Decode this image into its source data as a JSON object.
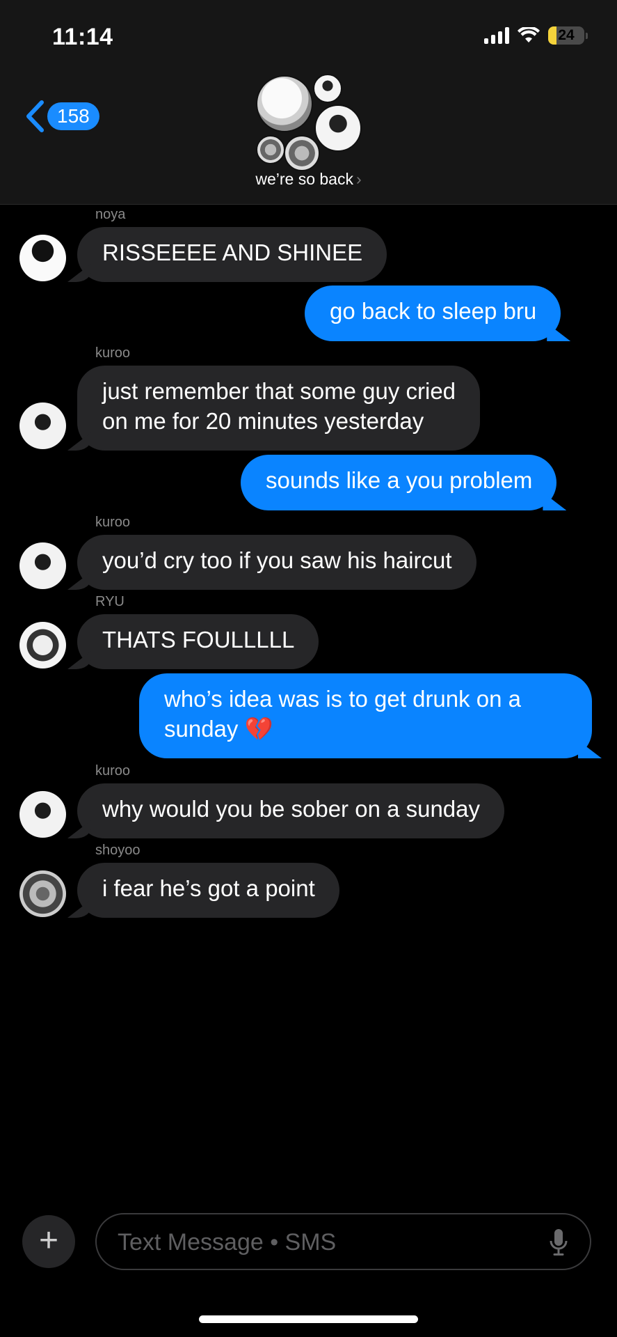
{
  "status_bar": {
    "time": "11:14",
    "battery": "24",
    "battery_level": 0.24
  },
  "header": {
    "back_count": "158",
    "group_name": "we’re so back",
    "chevron": "›"
  },
  "messages": [
    {
      "sender": "noya",
      "text": "RISSEEEE AND SHINEE"
    },
    {
      "text": "go back to sleep bru"
    },
    {
      "sender": "kuroo",
      "text": "just remember that some guy cried\non me for 20 minutes yesterday"
    },
    {
      "text": "sounds like a you problem"
    },
    {
      "sender": "kuroo",
      "text": "you’d cry too if you saw his haircut"
    },
    {
      "sender": "RYU",
      "text": "THATS FOULLLLL"
    },
    {
      "text": "who’s idea was is to get drunk on a\nsunday 💔"
    },
    {
      "sender": "kuroo",
      "text": "why would you be sober on a sunday"
    },
    {
      "sender": "shoyoo",
      "text": "i fear he’s got a point"
    }
  ],
  "composer": {
    "add": "+",
    "placeholder": "Text Message • SMS"
  },
  "colors": {
    "outgoing": "#0a84ff",
    "incoming": "#262628",
    "background": "#000000",
    "battery": "#f5d33b"
  },
  "icons": [
    "back-chevron-icon",
    "signal-icon",
    "wifi-icon",
    "battery-icon",
    "plus-icon",
    "microphone-icon"
  ]
}
